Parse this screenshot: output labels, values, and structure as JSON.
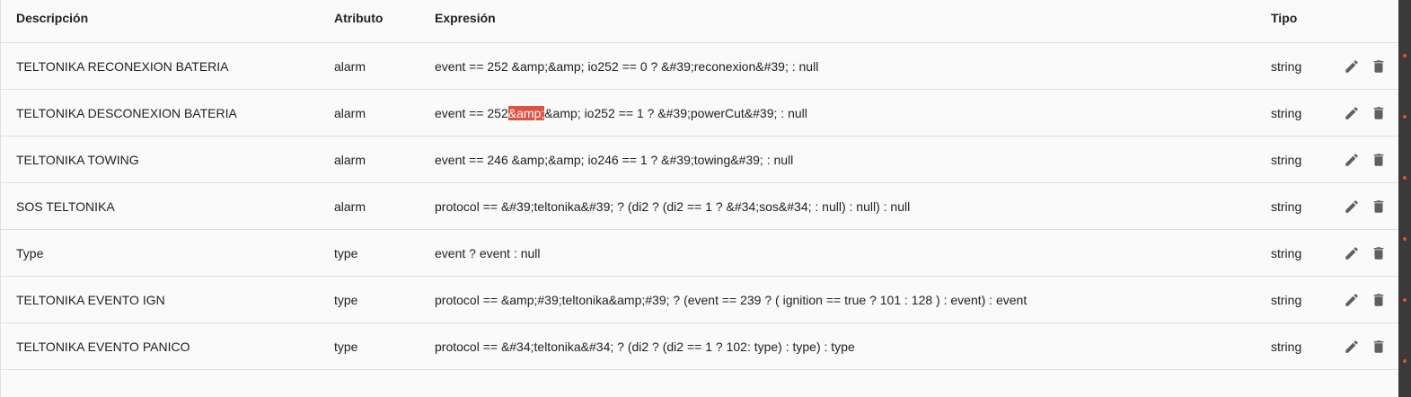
{
  "table": {
    "headers": {
      "description": "Descripción",
      "attribute": "Atributo",
      "expression": "Expresión",
      "type": "Tipo"
    },
    "rows": [
      {
        "description": "TELTONIKA RECONEXION BATERIA",
        "attribute": "alarm",
        "expression_pre": "event == 252 &amp;&amp; io252 == 0 ? &#39;reconexion&#39; : null",
        "expression_hl": "",
        "expression_post": "",
        "type": "string"
      },
      {
        "description": "TELTONIKA DESCONEXION BATERIA",
        "attribute": "alarm",
        "expression_pre": "event == 252 ",
        "expression_hl": "&amp;",
        "expression_post": "&amp; io252 == 1 ? &#39;powerCut&#39; : null",
        "type": "string"
      },
      {
        "description": "TELTONIKA TOWING",
        "attribute": "alarm",
        "expression_pre": "event == 246 &amp;&amp; io246 == 1 ? &#39;towing&#39; : null",
        "expression_hl": "",
        "expression_post": "",
        "type": "string"
      },
      {
        "description": "SOS TELTONIKA",
        "attribute": "alarm",
        "expression_pre": "protocol == &#39;teltonika&#39; ? (di2 ? (di2 == 1 ? &#34;sos&#34; : null) : null) : null",
        "expression_hl": "",
        "expression_post": "",
        "type": "string"
      },
      {
        "description": "Type",
        "attribute": "type",
        "expression_pre": "event ? event : null",
        "expression_hl": "",
        "expression_post": "",
        "type": "string"
      },
      {
        "description": "TELTONIKA EVENTO IGN",
        "attribute": "type",
        "expression_pre": "protocol == &amp;#39;teltonika&amp;#39; ? (event == 239 ? ( ignition == true ? 101 : 128 ) : event) : event",
        "expression_hl": "",
        "expression_post": "",
        "type": "string"
      },
      {
        "description": "TELTONIKA EVENTO PANICO",
        "attribute": "type",
        "expression_pre": "protocol == &#34;teltonika&#34; ? (di2 ? (di2 == 1 ? 102: type) : type) : type",
        "expression_hl": "",
        "expression_post": "",
        "type": "string"
      }
    ],
    "actions": {
      "edit_icon": "pencil-icon",
      "delete_icon": "trash-icon"
    }
  },
  "colors": {
    "highlight": "#e0513f",
    "right_strip": "#3a3a3a",
    "dots": "#e2532c"
  }
}
